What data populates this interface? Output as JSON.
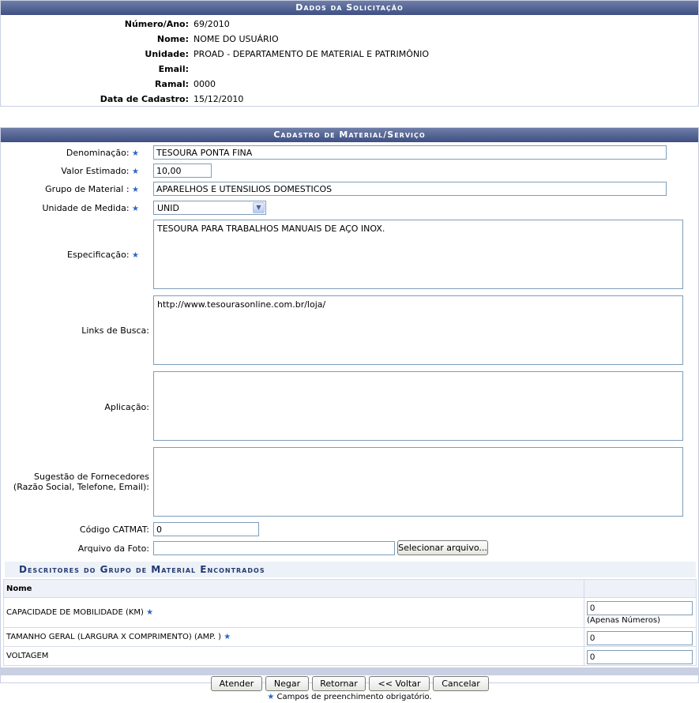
{
  "request": {
    "caption": "Dados da Solicitação",
    "fields": [
      {
        "label": "Número/Ano:",
        "value": "69/2010"
      },
      {
        "label": "Nome:",
        "value": "NOME DO USUÁRIO"
      },
      {
        "label": "Unidade:",
        "value": "PROAD - DEPARTAMENTO DE MATERIAL E PATRIMÔNIO"
      },
      {
        "label": "Email:",
        "value": ""
      },
      {
        "label": "Ramal:",
        "value": "0000"
      },
      {
        "label": "Data de Cadastro:",
        "value": "15/12/2010"
      }
    ]
  },
  "form": {
    "caption": "Cadastro de Material/Serviço",
    "denominacao": {
      "label": "Denominação:",
      "value": "TESOURA PONTA FINA"
    },
    "valor": {
      "label": "Valor Estimado:",
      "value": "10,00"
    },
    "grupo": {
      "label": "Grupo de Material :",
      "value": "APARELHOS E UTENSILIOS DOMESTICOS"
    },
    "unidade": {
      "label": "Unidade de Medida:",
      "value": "UNID"
    },
    "especificacao": {
      "label": "Especificação:",
      "value": "TESOURA PARA TRABALHOS MANUAIS DE AÇO INOX."
    },
    "links": {
      "label": "Links de Busca:",
      "value": "http://www.tesourasonline.com.br/loja/"
    },
    "aplicacao": {
      "label": "Aplicação:",
      "value": ""
    },
    "fornecedores": {
      "label_line1": "Sugestão de Fornecedores",
      "label_line2": "(Razão Social, Telefone, Email):",
      "value": ""
    },
    "catmat": {
      "label": "Código CATMAT:",
      "value": "0"
    },
    "foto": {
      "label": "Arquivo da Foto:",
      "button": "Selecionar arquivo..."
    },
    "required_star": "★"
  },
  "descriptors": {
    "title": "Descritores do Grupo de Material Encontrados",
    "header": "Nome",
    "rows": [
      {
        "name": "CAPACIDADE DE MOBILIDADE (KM)",
        "required": true,
        "value": "0",
        "hint": "(Apenas Números)"
      },
      {
        "name": "TAMANHO GERAL (LARGURA X COMPRIMENTO) (AMP. )",
        "required": true,
        "value": "0",
        "hint": ""
      },
      {
        "name": "VOLTAGEM",
        "required": false,
        "value": "0",
        "hint": ""
      }
    ]
  },
  "buttons": {
    "atender": "Atender",
    "negar": "Negar",
    "retornar": "Retornar",
    "voltar": "<< Voltar",
    "cancelar": "Cancelar"
  },
  "footer": {
    "note": "Campos de preenchimento obrigatório."
  },
  "colors": {
    "caption_bg": "#3e4f82",
    "star": "#2b64c5",
    "border": "#c9d0e2"
  }
}
